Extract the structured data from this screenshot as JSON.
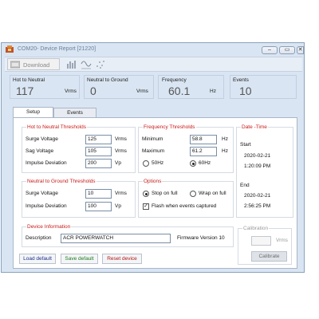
{
  "window": {
    "title": "COM20- Device Report [21220]",
    "controls": {
      "minimize": "–",
      "restore": "▭",
      "close": "✕"
    }
  },
  "toolbar": {
    "download_label": "Download",
    "icons": [
      "download-icon",
      "bar-graph-icon",
      "waveform-icon",
      "scatter-icon"
    ]
  },
  "readouts": [
    {
      "label": "Hot to Neutral",
      "value": "117",
      "unit": "Vrms"
    },
    {
      "label": "Neutral to Ground",
      "value": "0",
      "unit": "Vrms"
    },
    {
      "label": "Frequency",
      "value": "60.1",
      "unit": "Hz"
    },
    {
      "label": "Events",
      "value": "10",
      "unit": ""
    }
  ],
  "tabs": [
    {
      "label": "Setup",
      "active": true
    },
    {
      "label": "Events",
      "active": false
    }
  ],
  "hot_to_neutral": {
    "title": "Hot to Neutral Thresholds",
    "rows": [
      {
        "label": "Surge Voltage",
        "value": "125",
        "unit": "Vrms"
      },
      {
        "label": "Sag Voltage",
        "value": "105",
        "unit": "Vrms"
      },
      {
        "label": "Impulse Deviation",
        "value": "200",
        "unit": "Vp"
      }
    ]
  },
  "neutral_to_ground": {
    "title": "Neutral to Ground Thresholds",
    "rows": [
      {
        "label": "Surge Voltage",
        "value": "10",
        "unit": "Vrms"
      },
      {
        "label": "Impulse Deviation",
        "value": "100",
        "unit": "Vp"
      }
    ]
  },
  "frequency": {
    "title": "Frequency Thresholds",
    "min_label": "Minimum",
    "min_value": "58.8",
    "min_unit": "Hz",
    "max_label": "Maximum",
    "max_value": "61.2",
    "max_unit": "Hz",
    "radio_50": "50Hz",
    "radio_60": "60Hz",
    "selected": "60Hz"
  },
  "options": {
    "title": "Options",
    "stop_on_full": "Stop on full",
    "wrap_on_full": "Wrap on full",
    "selected": "Stop on full",
    "flash_label": "Flash when events captured",
    "flash_checked": true
  },
  "datetime": {
    "title": "Date -Time",
    "start_label": "Start",
    "start_date": "2020-02-21",
    "start_time": "1:20:09 PM",
    "end_label": "End",
    "end_date": "2020-02-21",
    "end_time": "2:56:25 PM"
  },
  "device_info": {
    "title": "Device Information",
    "description_label": "Description",
    "description_value": "ACR POWERWATCH",
    "firmware": "Firmware Version 10"
  },
  "calibration": {
    "title": "Calibration",
    "value": "",
    "unit": "Vrms",
    "button": "Calibrate"
  },
  "buttons": {
    "load_default": "Load default",
    "save_default": "Save default",
    "reset_device": "Reset device"
  },
  "colors": {
    "group_title": "#c81a1a",
    "load_text": "#1b2f8c",
    "save_text": "#1b7a1b",
    "reset_text": "#b01515",
    "readout_bg": "#d9e5f3"
  }
}
